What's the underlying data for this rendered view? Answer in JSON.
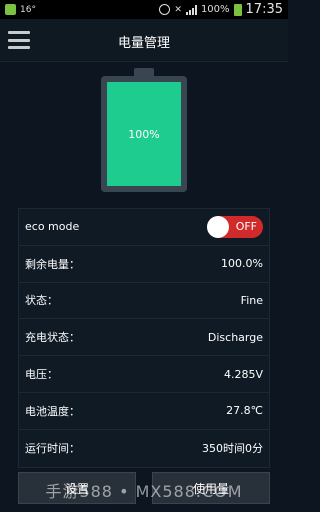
{
  "status_bar": {
    "temperature": "16°",
    "battery_percent": "100%",
    "time": "17:35"
  },
  "header": {
    "title": "电量管理"
  },
  "battery": {
    "level": 100,
    "label": "100%",
    "fill_color": "#1fcc8f"
  },
  "settings": {
    "eco_label": "eco mode",
    "eco_toggle_text": "OFF",
    "rows": [
      {
        "label": "剩余电量：",
        "value": "100.0%"
      },
      {
        "label": "状态：",
        "value": "Fine"
      },
      {
        "label": "充电状态：",
        "value": "Discharge"
      },
      {
        "label": "电压：",
        "value": "4.285V"
      },
      {
        "label": "电池温度：",
        "value": "27.8℃"
      },
      {
        "label": "运行时间：",
        "value": "350时间0分"
      }
    ]
  },
  "buttons": {
    "settings_label": "设置",
    "usage_label": "使用量"
  },
  "watermark": "手游588 • MX588.COM",
  "colors": {
    "accent_green": "#1fcc8f",
    "toggle_off_red": "#d02a2a"
  }
}
